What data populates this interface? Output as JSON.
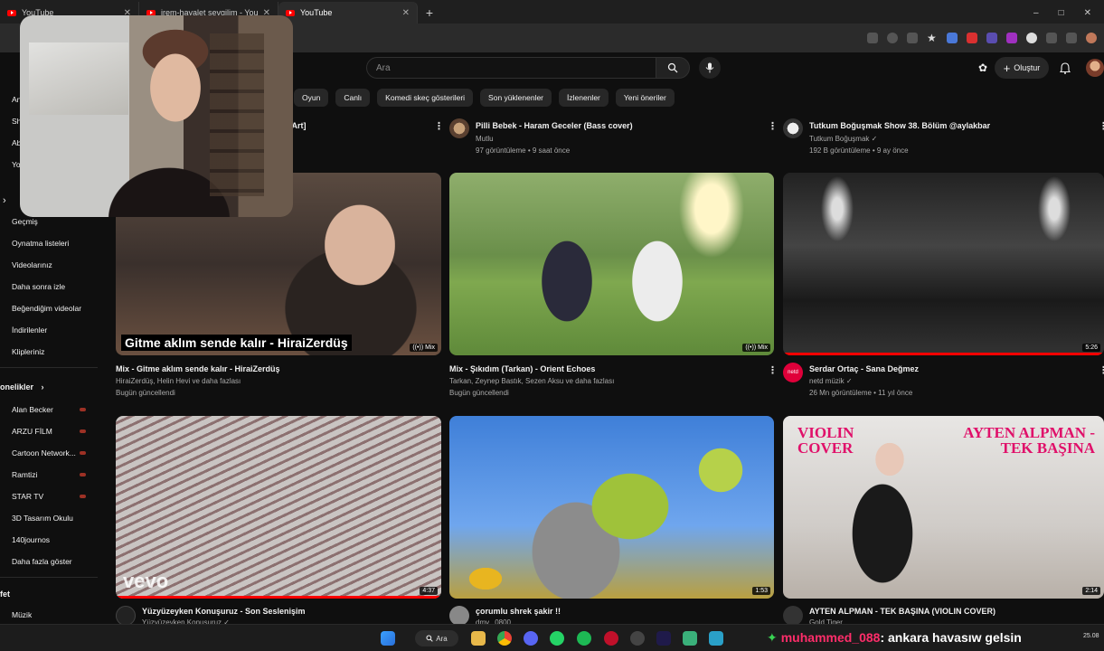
{
  "browser": {
    "tabs": [
      {
        "title": "YouTube",
        "active": false
      },
      {
        "title": "irem-hayalet sevgilim - YouTube",
        "active": false
      },
      {
        "title": "YouTube",
        "active": true
      }
    ],
    "new_tab": "+",
    "window_controls": [
      "–",
      "□",
      "✕"
    ]
  },
  "youtube": {
    "search_placeholder": "Ara",
    "create_label": "Oluştur",
    "create_plus": "+",
    "chips": [
      "Oyun",
      "Canlı",
      "Komedi skeç gösterileri",
      "Son yüklenenler",
      "İzlenenler",
      "Yeni öneriler"
    ]
  },
  "sidebar": {
    "partial_top": [
      "An",
      "Sh",
      "Ab",
      "Yo"
    ],
    "expand_chevron": "›",
    "items": [
      "Geçmiş",
      "Oynatma listeleri",
      "Videolarınız",
      "Daha sonra izle",
      "Beğendiğim videolar",
      "İndirilenler",
      "Klipleriniz"
    ],
    "subscriptions_title": "onelikler",
    "subscriptions_chevron": "›",
    "subscriptions": [
      {
        "name": "Alan Becker",
        "live": true
      },
      {
        "name": "ARZU FİLM",
        "live": true
      },
      {
        "name": "Cartoon Network...",
        "live": true
      },
      {
        "name": "Ramtizi",
        "live": true
      },
      {
        "name": "STAR TV",
        "live": true
      },
      {
        "name": "3D Tasarım Okulu",
        "live": false
      },
      {
        "name": "140journos",
        "live": false
      },
      {
        "name": "Daha fazla göster",
        "live": false
      }
    ],
    "explore_title": "fet",
    "explore_items": [
      "Müzik"
    ]
  },
  "videos": {
    "row0": [
      {
        "title": "eoArt]",
        "meta1": "",
        "meta2": ""
      },
      {
        "title": "Pilli Bebek - Haram Geceler (Bass cover)",
        "meta1": "Mutlu",
        "meta2": "97 görüntüleme • 9 saat önce"
      },
      {
        "title": "Tutkum Boğuşmak Show 38. Bölüm @aylakbar",
        "meta1": "Tutkum Boğuşmak ✓",
        "meta2": "192 B görüntüleme • 9 ay önce"
      }
    ],
    "row1": [
      {
        "title": "Mix - Gitme aklım sende kalır - HiraiZerdüş",
        "meta1": "HiraiZerdüş, Helin Hevi ve daha fazlası",
        "meta2": "Bugün güncellendi",
        "badge": "Mix",
        "caption": "Gitme aklım sende kalır - HiraiZerdüş"
      },
      {
        "title": "Mix - Şıkıdım (Tarkan) - Orient Echoes",
        "meta1": "Tarkan, Zeynep Bastık, Sezen Aksu ve daha fazlası",
        "meta2": "Bugün güncellendi",
        "badge": "Mix"
      },
      {
        "title": "Serdar Ortaç - Sana Değmez",
        "meta1": "netd müzik ✓",
        "meta2": "26 Mn görüntüleme • 11 yıl önce",
        "duration": "5:26",
        "progress": 1.0,
        "avatar_text": "netd"
      }
    ],
    "row2": [
      {
        "title": "Yüzyüzeyken Konuşuruz - Son Seslenişim",
        "meta1": "Yüzyüzeyken Konuşuruz ✓",
        "duration": "4:37",
        "progress": 1.0,
        "watermark": "vevo"
      },
      {
        "title": "çorumlu shrek şakir !!",
        "meta1": "dmv...0800",
        "duration": "1:53"
      },
      {
        "title": "AYTEN ALPMAN - TEK BAŞINA (VIOLIN COVER)",
        "meta1": "Gold Tiger",
        "duration": "2:14",
        "overlay_left": "VIOLIN COVER",
        "overlay_right": "AYTEN ALPMAN - TEK BAŞINA"
      }
    ],
    "kebab": "⋮"
  },
  "taskbar": {
    "search_label": "Ara",
    "chat_user": "muhammed_088",
    "chat_message": ": ankara havasıw gelsin",
    "clock": "25.08"
  },
  "colors": {
    "accent": "#ff0000",
    "chat_user": "#ff2d6a",
    "bg": "#0f0f0f"
  }
}
